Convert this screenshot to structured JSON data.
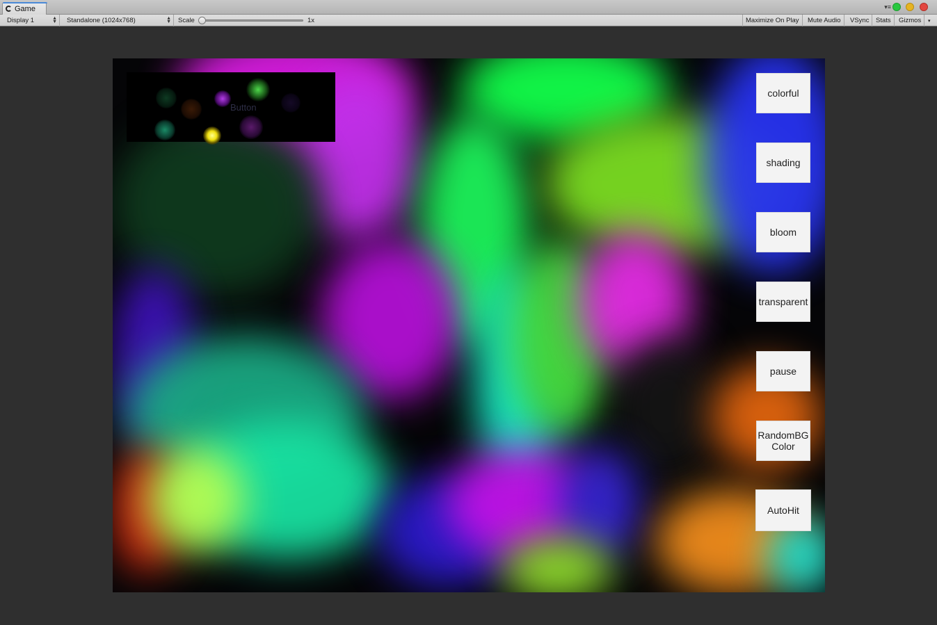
{
  "window": {
    "tab_label": "Game",
    "menu_glyph": "▾≡",
    "dots": {
      "green": "#28c840",
      "yellow": "#e6b422",
      "red": "#e2463f"
    }
  },
  "toolbar": {
    "display_label": "Display 1",
    "resolution_label": "Standalone (1024x768)",
    "scale_label": "Scale",
    "scale_value_label": "1x",
    "scale_value": 1,
    "maximize_label": "Maximize On Play",
    "mute_label": "Mute Audio",
    "vsync_label": "VSync",
    "stats_label": "Stats",
    "gizmos_label": "Gizmos"
  },
  "game": {
    "preview_button_label": "Button",
    "buttons": [
      {
        "label": "colorful"
      },
      {
        "label": "shading"
      },
      {
        "label": "bloom"
      },
      {
        "label": "transparent"
      },
      {
        "label": "pause"
      },
      {
        "label": "RandomBG\nColor"
      },
      {
        "label": "AutoHit"
      }
    ]
  }
}
